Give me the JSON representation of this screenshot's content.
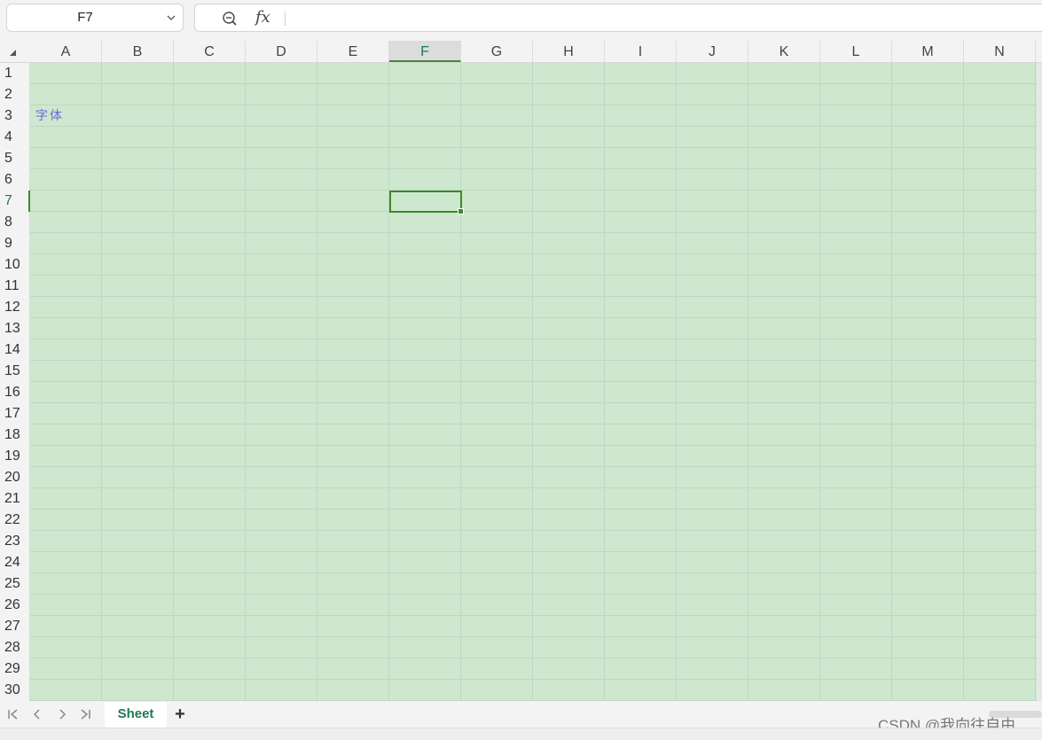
{
  "name_box": {
    "value": "F7"
  },
  "formula_bar": {
    "fx_label": "fx",
    "content": ""
  },
  "columns": [
    "A",
    "B",
    "C",
    "D",
    "E",
    "F",
    "G",
    "H",
    "I",
    "J",
    "K",
    "L",
    "M",
    "N"
  ],
  "active_column": "F",
  "rows": [
    "1",
    "2",
    "3",
    "4",
    "5",
    "6",
    "7",
    "8",
    "9",
    "10",
    "11",
    "12",
    "13",
    "14",
    "15",
    "16",
    "17",
    "18",
    "19",
    "20",
    "21",
    "22",
    "23",
    "24",
    "25",
    "26",
    "27",
    "28",
    "29",
    "30"
  ],
  "active_row": "7",
  "cells": {
    "A3": "字体"
  },
  "selected_cell": "F7",
  "sheet_tabs": [
    {
      "label": "Sheet",
      "active": true
    }
  ],
  "add_sheet_label": "+",
  "watermark": "CSDN @我向往自由",
  "colors": {
    "grid_fill": "#cde8cf",
    "accent": "#3d8a2b",
    "tab_text": "#1e7a52",
    "cell_text": "#6b6bd8"
  }
}
